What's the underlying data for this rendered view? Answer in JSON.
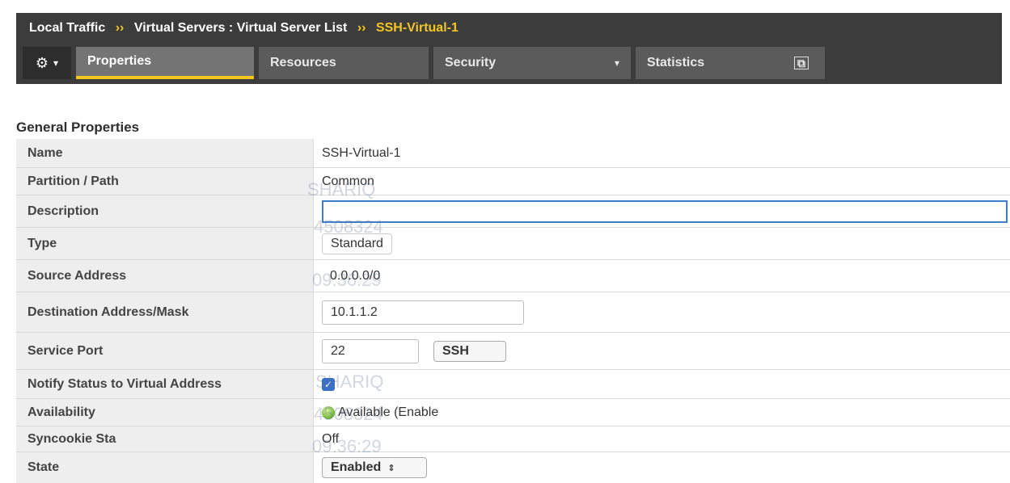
{
  "breadcrumb": {
    "items": [
      "Local Traffic",
      "Virtual Servers : Virtual Server List"
    ],
    "separator": "››",
    "current": "SSH-Virtual-1"
  },
  "tabs": [
    {
      "label": "Properties",
      "active": true
    },
    {
      "label": "Resources",
      "active": false
    },
    {
      "label": "Security",
      "active": false
    },
    {
      "label": "Statistics",
      "active": false
    }
  ],
  "icons": {
    "gear": "⚙",
    "chevron": "▾",
    "external": "⧉"
  },
  "section": {
    "title": "General Properties"
  },
  "properties": {
    "name": {
      "label": "Name",
      "value": "SSH-Virtual-1"
    },
    "partition": {
      "label": "Partition / Path",
      "value": "Common"
    },
    "description": {
      "label": "Description",
      "value": ""
    },
    "type": {
      "label": "Type",
      "value": "Standard"
    },
    "source_address": {
      "label": "Source Address",
      "value": "0.0.0.0/0"
    },
    "destination": {
      "label": "Destination Address/Mask",
      "value": "10.1.1.2"
    },
    "service_port": {
      "label": "Service Port",
      "port": "22",
      "protocol": "SSH"
    },
    "notify": {
      "label": "Notify Status to Virtual Address",
      "checked": true
    },
    "availability": {
      "label": "Availability",
      "value": "Available (Enable"
    },
    "syncookie": {
      "label": "Syncookie Sta",
      "value": "Off"
    },
    "state": {
      "label": "State",
      "value": "Enabled"
    }
  },
  "watermarks": [
    "SHARIQ",
    "4508324",
    "09:36:29"
  ],
  "colors": {
    "header_bg": "#3c3c3c",
    "accent": "#f3c623",
    "focus_border": "#3d7ec8",
    "label_bg": "#eeeeee"
  }
}
